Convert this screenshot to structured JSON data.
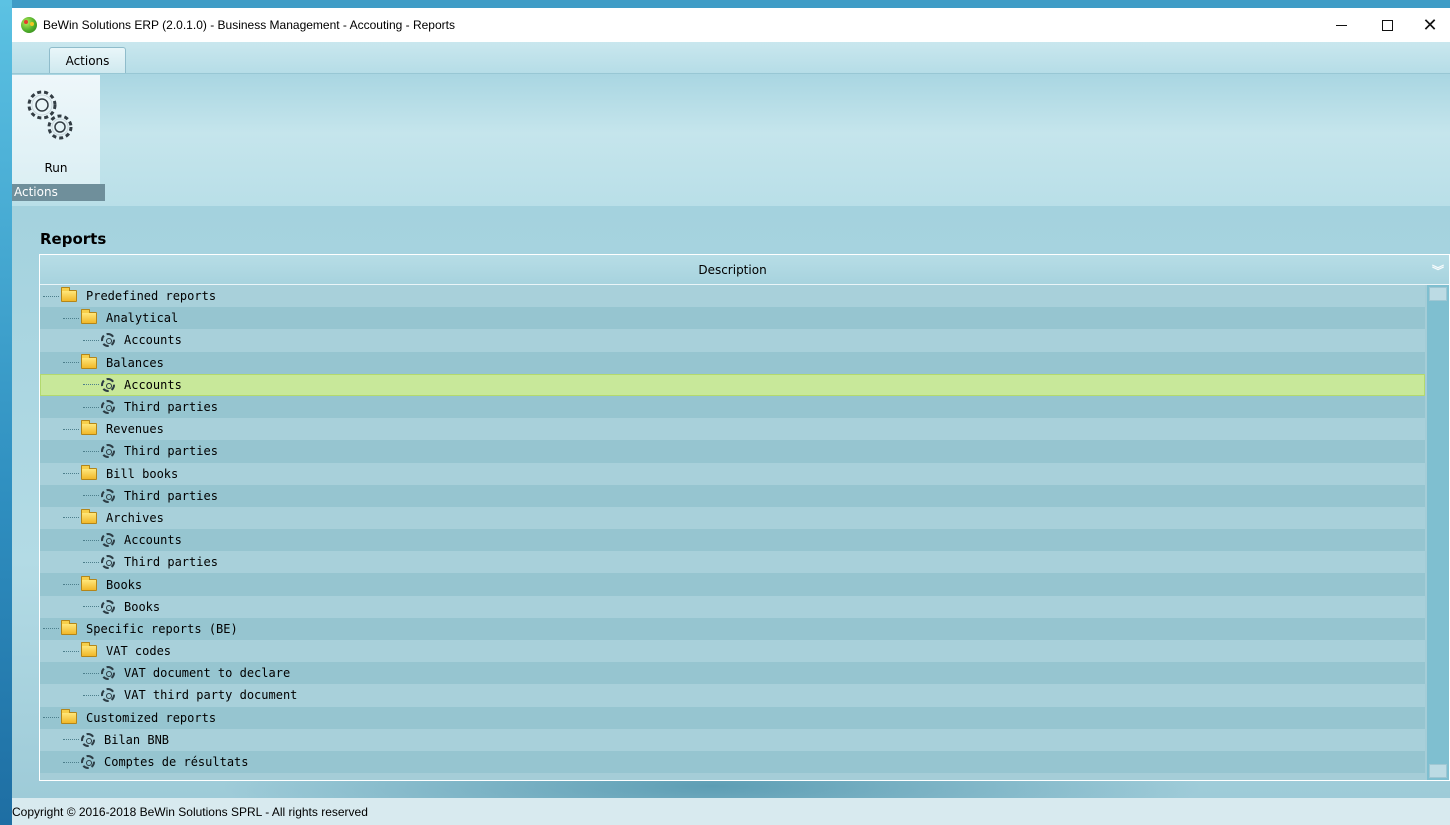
{
  "window": {
    "title": "BeWin Solutions ERP (2.0.1.0)  - Business Management - Accouting - Reports",
    "controls": [
      "minimize",
      "maximize",
      "close"
    ]
  },
  "ribbon": {
    "tabs": [
      {
        "label": "Actions"
      }
    ],
    "groups": [
      {
        "label": "Actions",
        "buttons": [
          {
            "label": "Run",
            "icon": "gears-icon"
          }
        ]
      }
    ]
  },
  "reports": {
    "title": "Reports",
    "column_header": "Description",
    "rows": [
      {
        "label": "Predefined reports",
        "level": 0,
        "type": "folder"
      },
      {
        "label": "Analytical",
        "level": 1,
        "type": "folder"
      },
      {
        "label": "Accounts",
        "level": 2,
        "type": "report"
      },
      {
        "label": "Balances",
        "level": 1,
        "type": "folder"
      },
      {
        "label": "Accounts",
        "level": 2,
        "type": "report",
        "selected": true
      },
      {
        "label": "Third parties",
        "level": 2,
        "type": "report"
      },
      {
        "label": "Revenues",
        "level": 1,
        "type": "folder"
      },
      {
        "label": "Third parties",
        "level": 2,
        "type": "report"
      },
      {
        "label": "Bill books",
        "level": 1,
        "type": "folder"
      },
      {
        "label": "Third parties",
        "level": 2,
        "type": "report"
      },
      {
        "label": "Archives",
        "level": 1,
        "type": "folder"
      },
      {
        "label": "Accounts",
        "level": 2,
        "type": "report"
      },
      {
        "label": "Third parties",
        "level": 2,
        "type": "report"
      },
      {
        "label": "Books",
        "level": 1,
        "type": "folder"
      },
      {
        "label": "Books",
        "level": 2,
        "type": "report"
      },
      {
        "label": "Specific reports (BE)",
        "level": 0,
        "type": "folder"
      },
      {
        "label": "VAT codes",
        "level": 1,
        "type": "folder"
      },
      {
        "label": "VAT document to declare",
        "level": 2,
        "type": "report"
      },
      {
        "label": "VAT third party document",
        "level": 2,
        "type": "report"
      },
      {
        "label": "Customized reports",
        "level": 0,
        "type": "folder"
      },
      {
        "label": "Bilan BNB",
        "level": 1,
        "type": "report"
      },
      {
        "label": "Comptes de résultats",
        "level": 1,
        "type": "report"
      }
    ]
  },
  "status": {
    "copyright": "Copyright © 2016-2018 BeWin Solutions SPRL - All rights reserved"
  },
  "colors": {
    "selected_row": "#c8e89a",
    "row_odd": "#a8d0da",
    "row_even": "#96c5d0",
    "background": "#a6d3df"
  }
}
